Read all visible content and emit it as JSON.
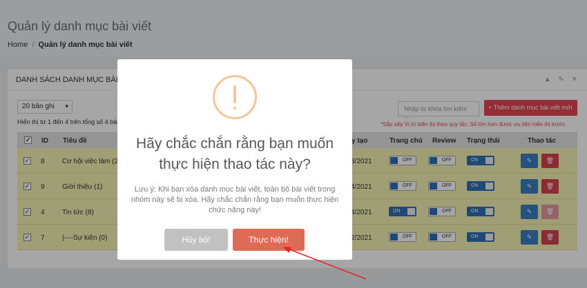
{
  "page": {
    "title": "Quản lý danh mục bài viết",
    "breadcrumb": {
      "home": "Home",
      "separator": "/",
      "current": "Quản lý danh mục bài viết"
    }
  },
  "portlet": {
    "title": "DANH SÁCH DANH MỤC BÀI VIẾT",
    "tools": "▲ ✎ ✕"
  },
  "toolbar": {
    "page_size": "20 bản ghi",
    "info": "Hiển thị từ 1 đến 4 trên tổng số 4 bản",
    "search_placeholder": "Nhập từ khóa tìm kiếm ...",
    "add_label": "+ Thêm danh mục bài viết mới",
    "sort_note": "*Sắp xếp Vị trí hiển thị theo quy tắc: Số lớn hơn được ưu tiên hiển thị trước."
  },
  "table": {
    "headers": {
      "id": "ID",
      "title": "Tiêu đề",
      "created": "y tạo",
      "home": "Trang chủ",
      "review": "Review",
      "status": "Trạng thái",
      "actions": "Thao tác"
    },
    "rows": [
      {
        "id": "8",
        "title": "Cơ hội việc làm (2)",
        "created": "3/2021",
        "home": "OFF",
        "review": "OFF",
        "status": "ON"
      },
      {
        "id": "9",
        "title": "Giới thiệu (1)",
        "created": "4/2021",
        "home": "OFF",
        "review": "OFF",
        "status": "ON"
      },
      {
        "id": "4",
        "title": "Tin tức (8)",
        "created": "4/2021",
        "home": "ON",
        "review": "OFF",
        "status": "ON"
      },
      {
        "id": "7",
        "title": "|----Sự kiện (0)",
        "created": "2/2021",
        "home": "OFF",
        "review": "OFF",
        "status": "ON"
      }
    ]
  },
  "modal": {
    "title": "Hãy chắc chắn rằng bạn muốn thực hiện thao tác này?",
    "text": "Lưu ý: Khi bạn xóa danh mục bài viết, toàn bộ bài viết trong nhóm này sẽ bị xóa. Hãy chắc chắn rằng bạn muốn thực hiện chức năng này!",
    "cancel": "Hủy bỏ!",
    "confirm": "Thực hiện!"
  },
  "colors": {
    "accent": "#dd6b55",
    "warning": "#f5c597",
    "danger": "#e3454f",
    "primary": "#3a7ec2",
    "row_highlight": "#f4f3b2"
  },
  "icons": {
    "warning": "exclamation-icon",
    "edit": "edit-icon",
    "delete": "trash-icon",
    "link": "link-icon"
  }
}
